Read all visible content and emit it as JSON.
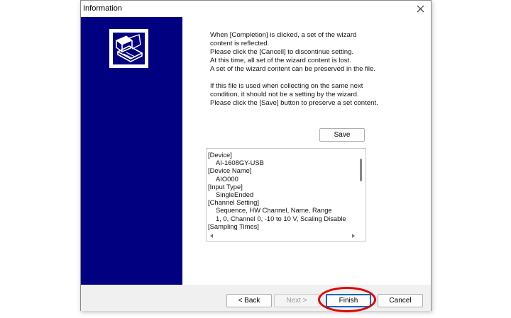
{
  "window": {
    "title": "Information",
    "close_symbol": "✕"
  },
  "description": {
    "lines": [
      "When [Completion] is clicked, a set of the wizard",
      "content is reflected.",
      "Please click the [Cancell] to discontinue setting.",
      "At this time, all set of the wizard content is lost.",
      "A set of the wizard content can be preserved in the file.",
      "",
      "If this file is used when collecting on the same next",
      "condition, it should not be a setting by the wizard.",
      "Please click the [Save] button to preserve a set content."
    ]
  },
  "save_button": {
    "label": "Save"
  },
  "summary_list": {
    "lines": [
      {
        "text": "[Device]",
        "indent": false
      },
      {
        "text": "AI-1608GY-USB",
        "indent": true
      },
      {
        "text": "[Device Name]",
        "indent": false
      },
      {
        "text": "AIO000",
        "indent": true
      },
      {
        "text": "[Input Type]",
        "indent": false
      },
      {
        "text": "SingleEnded",
        "indent": true
      },
      {
        "text": "[Channel Setting]",
        "indent": false
      },
      {
        "text": "Sequence, HW Channel, Name, Range",
        "indent": true
      },
      {
        "text": "1,  0,  Channel 0,  -10 to 10 V, Scaling Disable",
        "indent": true
      },
      {
        "text": "[Sampling Times]",
        "indent": false
      }
    ]
  },
  "buttons": {
    "back": "< Back",
    "next": "Next >",
    "finish": "Finish",
    "cancel": "Cancel"
  },
  "colors": {
    "side_panel": "#000080",
    "highlight": "#e00000",
    "default_button_border": "#0067c0"
  },
  "icons": {
    "logo": "wizard-computer-icon",
    "close": "close-icon"
  }
}
